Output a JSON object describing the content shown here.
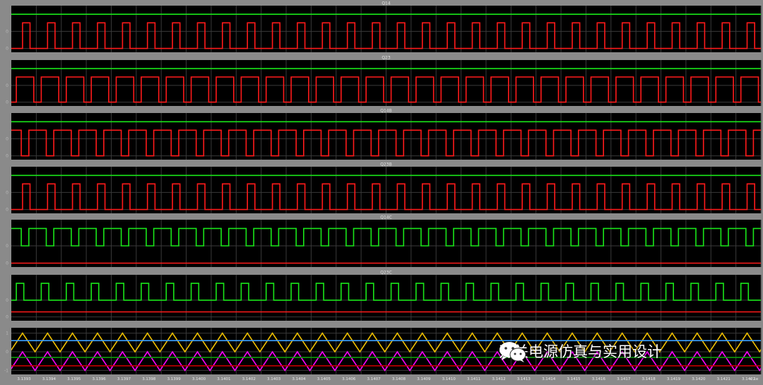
{
  "colors": {
    "panel_bg": "#000000",
    "frame": "#8a8a8a",
    "grid": "#3a3a3a",
    "label": "#b8b8b8",
    "red": "#ff1a1a",
    "green": "#19e619",
    "yellow": "#f0c000",
    "magenta": "#ff00ff",
    "blue": "#3aa0ff",
    "dark_green": "#0c9a0c",
    "dark_red": "#c00000"
  },
  "chart_data": {
    "type": "line",
    "x_ticks": [
      "3.1393",
      "3.1394",
      "3.1395",
      "3.1396",
      "3.1397",
      "3.1398",
      "3.1399",
      "3.1400",
      "3.1401",
      "3.1402",
      "3.1403",
      "3.1404",
      "3.1405",
      "3.1406",
      "3.1407",
      "3.1408",
      "3.1409",
      "3.1410",
      "3.1411",
      "3.1412",
      "3.1413",
      "3.1414",
      "3.1415",
      "3.1416",
      "3.1417",
      "3.1418",
      "3.1419",
      "3.1420",
      "3.1421",
      "3.1422"
    ],
    "x_unit": "× 1e",
    "xlim": [
      3.13925,
      3.14225
    ],
    "pulse_period": 0.0001,
    "subplots": [
      {
        "title": "Q14",
        "y_ticks": [
          "0",
          "0"
        ],
        "series": [
          {
            "color": "red",
            "kind": "pulse",
            "high": 0.75,
            "low": 0,
            "duty": 0.3,
            "phase": 4.5e-05
          },
          {
            "color": "green",
            "kind": "const",
            "value": 1
          }
        ]
      },
      {
        "title": "Q23",
        "y_ticks": [
          "0",
          "0"
        ],
        "series": [
          {
            "color": "red",
            "kind": "pulse",
            "high": 0.75,
            "low": 0,
            "duty": 0.7,
            "phase": 2e-05
          },
          {
            "color": "green",
            "kind": "const",
            "value": 1
          }
        ]
      },
      {
        "title": "Q14B",
        "y_ticks": [
          "0",
          "0"
        ],
        "series": [
          {
            "color": "red",
            "kind": "pulse",
            "high": 0.75,
            "low": 0,
            "duty": 0.7,
            "phase": 7e-05
          },
          {
            "color": "green",
            "kind": "const",
            "value": 1
          }
        ]
      },
      {
        "title": "Q23B",
        "y_ticks": [
          "0",
          "0"
        ],
        "series": [
          {
            "color": "red",
            "kind": "pulse",
            "high": 0.75,
            "low": 0,
            "duty": 0.3,
            "phase": 4.5e-05
          },
          {
            "color": "green",
            "kind": "const",
            "value": 1
          }
        ]
      },
      {
        "title": "Q14C",
        "y_ticks": [
          "0",
          "0"
        ],
        "series": [
          {
            "color": "green",
            "kind": "pulse",
            "high": 1,
            "low": 0.5,
            "duty": 0.7,
            "phase": 7e-05
          },
          {
            "color": "red",
            "kind": "const",
            "value": 0
          }
        ]
      },
      {
        "title": "Q23C",
        "y_ticks": [
          "0",
          "0"
        ],
        "series": [
          {
            "color": "green",
            "kind": "pulse",
            "high": 1,
            "low": 0.5,
            "duty": 0.3,
            "phase": 2e-05
          },
          {
            "color": "red",
            "kind": "const",
            "value": 0.15
          }
        ]
      },
      {
        "title": "",
        "y_ticks": [
          "1",
          "0",
          "-1"
        ],
        "series": [
          {
            "color": "yellow",
            "kind": "tri",
            "min": 0,
            "max": 1,
            "peak": 4.5e-05
          },
          {
            "color": "magenta",
            "kind": "tri",
            "min": -1,
            "max": 0,
            "peak": 4.5e-05
          },
          {
            "color": "blue",
            "kind": "const",
            "value": 0.6
          },
          {
            "color": "dark_green",
            "kind": "const",
            "value": -0.3
          },
          {
            "color": "dark_red",
            "kind": "const",
            "value": -0.75
          }
        ]
      }
    ]
  },
  "watermark": {
    "text": "开关电源仿真与实用设计",
    "icon": "wechat-icon"
  }
}
